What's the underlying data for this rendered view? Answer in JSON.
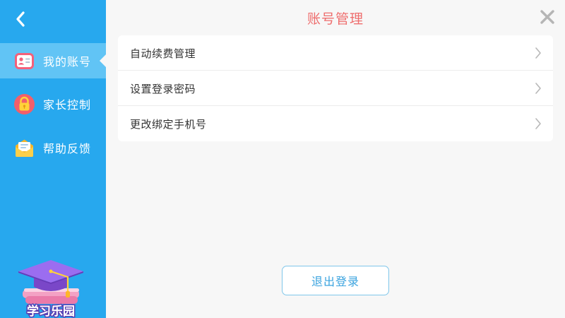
{
  "page": {
    "title": "账号管理"
  },
  "sidebar": {
    "items": [
      {
        "label": "我的账号",
        "icon": "id-card-icon",
        "active": true
      },
      {
        "label": "家长控制",
        "icon": "lock-icon",
        "active": false
      },
      {
        "label": "帮助反馈",
        "icon": "mail-icon",
        "active": false
      }
    ],
    "logo_text": "学习乐园"
  },
  "menu": {
    "items": [
      {
        "label": "自动续费管理"
      },
      {
        "label": "设置登录密码"
      },
      {
        "label": "更改绑定手机号"
      }
    ]
  },
  "actions": {
    "logout_label": "退出登录"
  },
  "colors": {
    "sidebar_bg": "#27a8ee",
    "sidebar_active_bg": "#61c4f5",
    "title": "#ee6e6e",
    "logout_text": "#3aa3df"
  }
}
